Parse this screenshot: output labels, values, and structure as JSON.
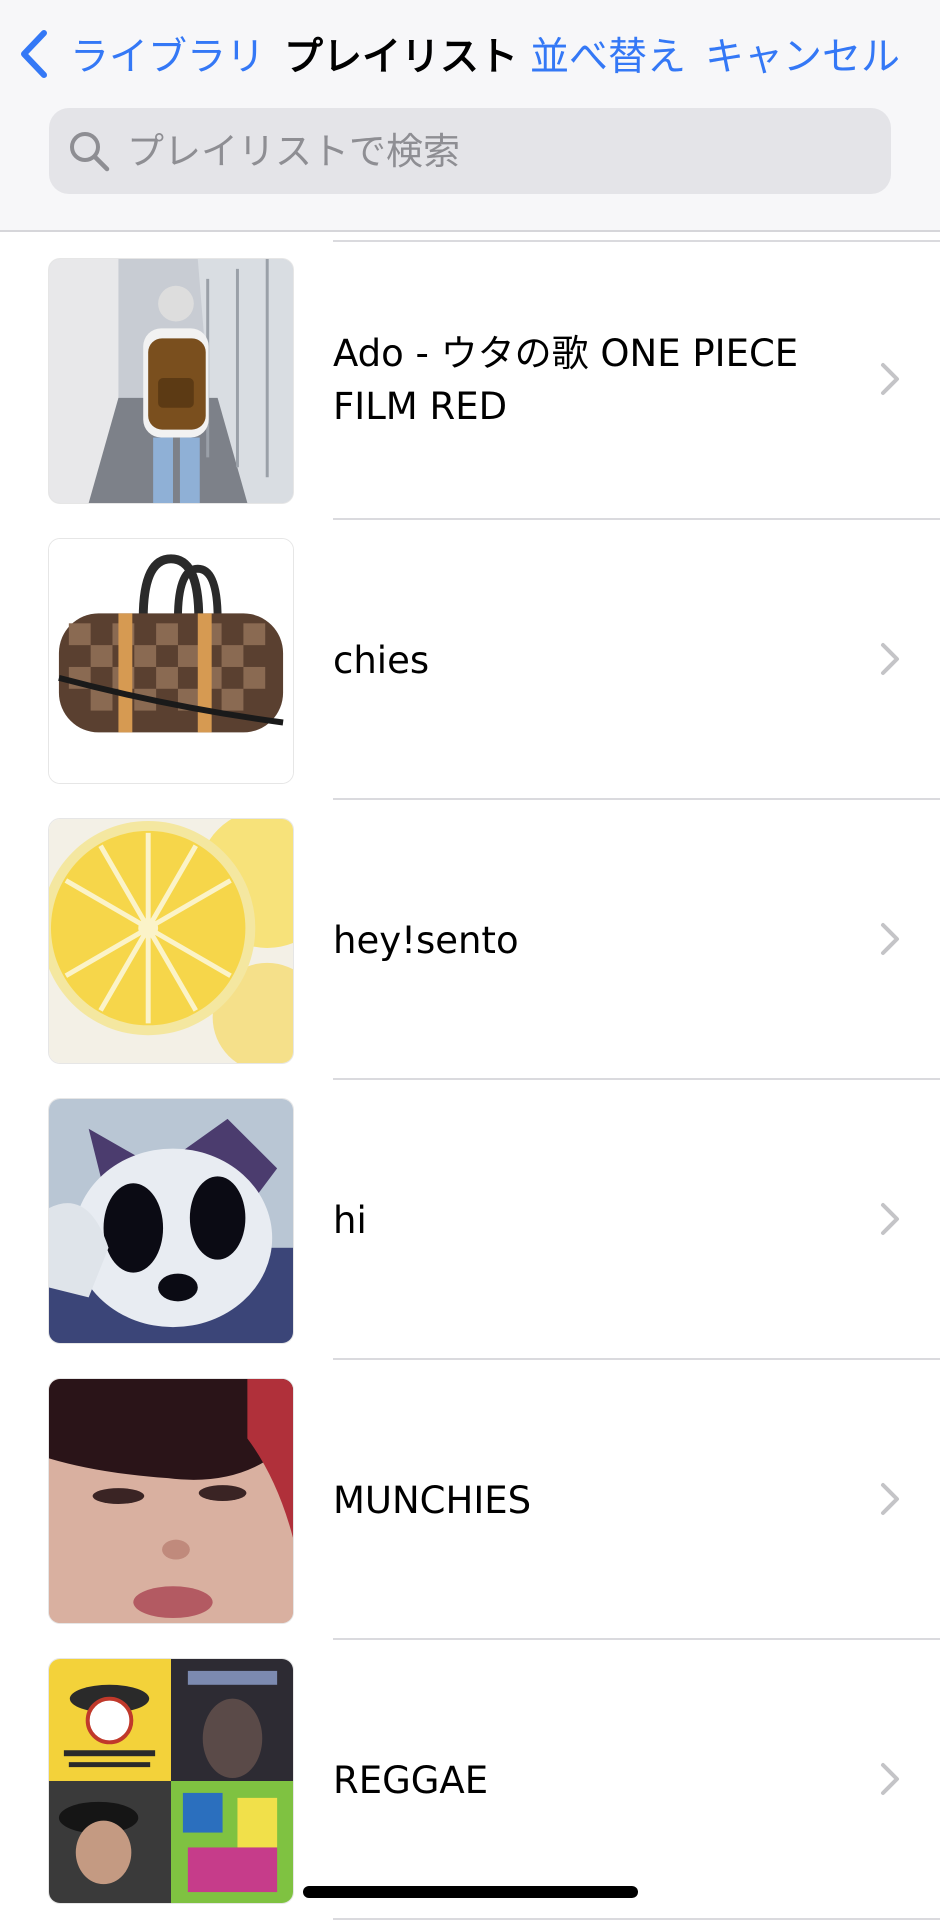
{
  "nav": {
    "back_label": "ライブラリ",
    "title": "プレイリスト",
    "sort_label": "並べ替え",
    "cancel_label": "キャンセル"
  },
  "search": {
    "placeholder": "プレイリストで検索",
    "icon": "search-icon"
  },
  "playlists": [
    {
      "name": "Ado - ウタの歌 ONE PIECE FILM RED",
      "art": "person-with-backpack"
    },
    {
      "name": "chies",
      "art": "brown-checkered-duffel-bag"
    },
    {
      "name": "hey!sento",
      "art": "lemon-slice"
    },
    {
      "name": "hi",
      "art": "cartoon-character"
    },
    {
      "name": "MUNCHIES",
      "art": "face-closeup"
    },
    {
      "name": "REGGAE",
      "art": "album-collage"
    }
  ],
  "colors": {
    "accent": "#3478f6",
    "separator": "#dadade",
    "header_bg": "#f7f7f9",
    "search_bg": "#e4e4e8",
    "chevron": "#c4c4c7"
  }
}
